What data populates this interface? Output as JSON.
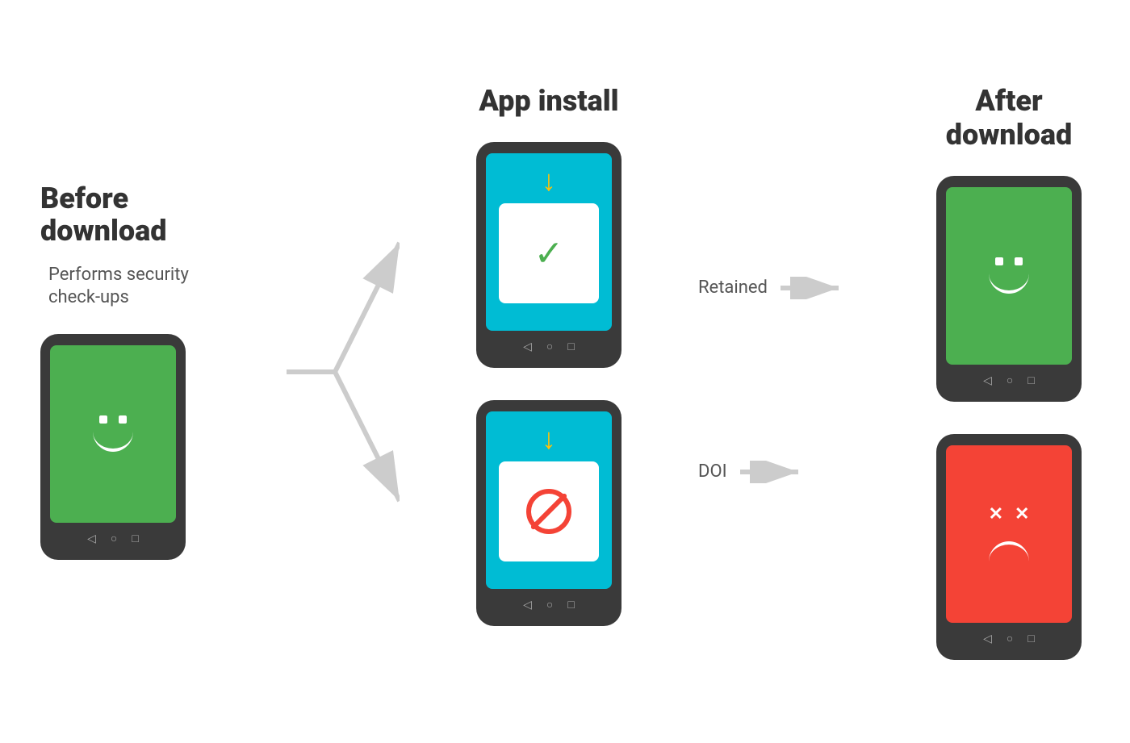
{
  "before": {
    "title": "Before download",
    "subtitle": "Performs security check-ups"
  },
  "install": {
    "title": "App install"
  },
  "after": {
    "title": "After download"
  },
  "labels": {
    "retained": "Retained",
    "doi": "DOI"
  },
  "nav_icons": {
    "back": "◁",
    "home": "○",
    "recent": "□"
  }
}
